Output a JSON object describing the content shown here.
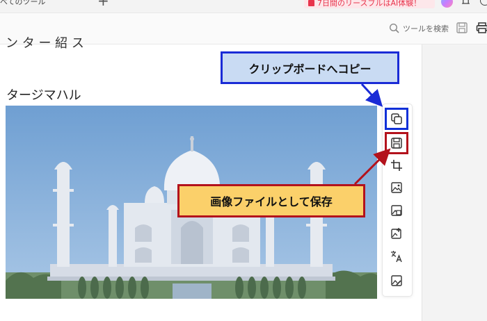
{
  "tabbar": {
    "tab_label": "べてのツール",
    "plus": "+",
    "promo_text": "7日間のリースブルはAI体験！"
  },
  "toolbar": {
    "search_label": "ツールを検索"
  },
  "document": {
    "top_text": "ン タ ー 紹 ス",
    "heading": "タージマハル"
  },
  "image_toolbar": {
    "items": [
      "copy",
      "save-as-file",
      "crop",
      "replace-image",
      "extract-image",
      "export-image",
      "translate-text",
      "edit-image"
    ]
  },
  "callouts": {
    "copy": "クリップボードへコピー",
    "save": "画像ファイルとして保存"
  },
  "colors": {
    "callout_blue_fill": "#c9dbf3",
    "callout_blue_border": "#1a2bd6",
    "callout_red_fill": "#fbd06a",
    "callout_red_border": "#b3121c",
    "promo": "#e8344c"
  }
}
